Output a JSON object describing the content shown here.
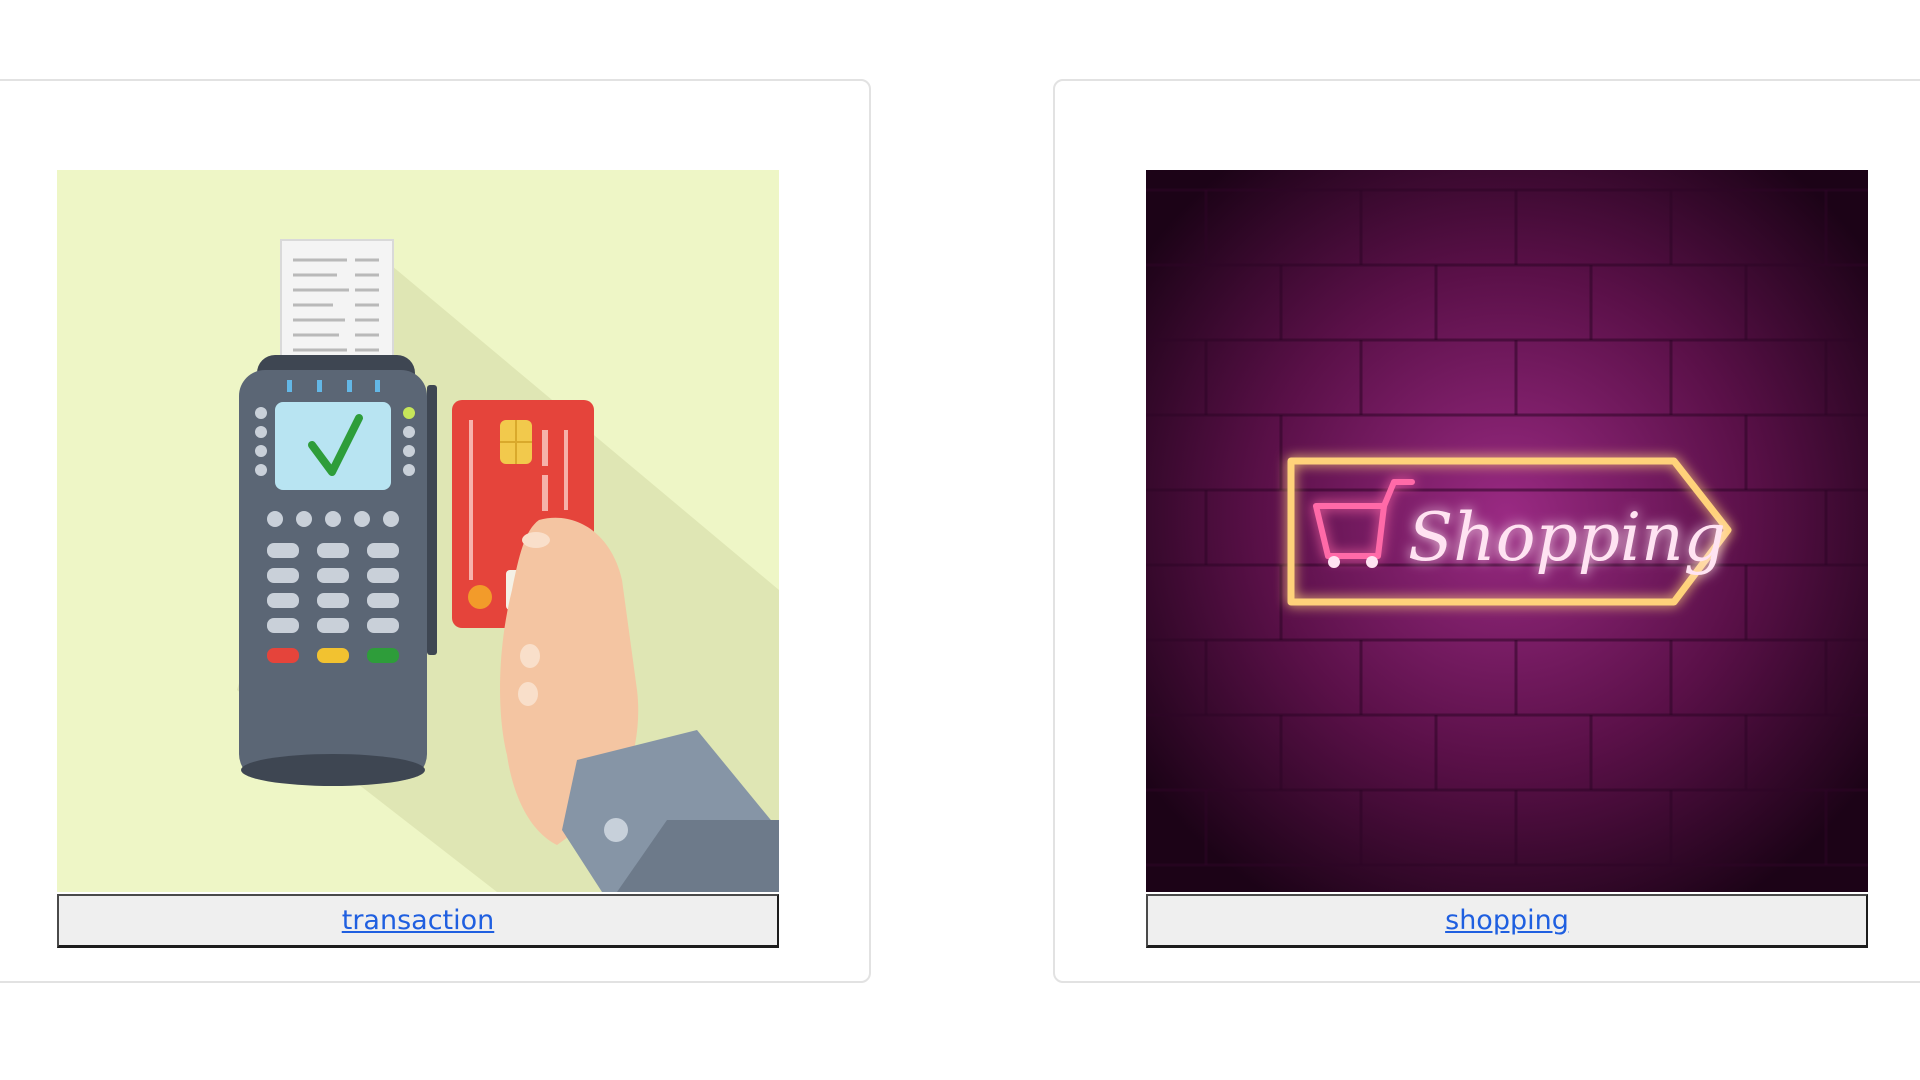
{
  "cards": [
    {
      "link_label": "transaction",
      "image_icon": "card-payment-terminal-illustration",
      "colors": {
        "background": "#eef6c6",
        "terminal": "#5b6675",
        "card": "#e5443b",
        "check": "#2e9d3a"
      }
    },
    {
      "link_label": "shopping",
      "image_icon": "neon-shopping-sign-illustration",
      "sign_text": "Shopping",
      "colors": {
        "wall": "#5a1048",
        "neon_frame": "#ffd27a",
        "neon_text": "#ffe3f2"
      }
    }
  ],
  "colors": {
    "link": "#1f5fe0",
    "caption_bg": "#efefef",
    "card_border": "#e2e2e2"
  }
}
